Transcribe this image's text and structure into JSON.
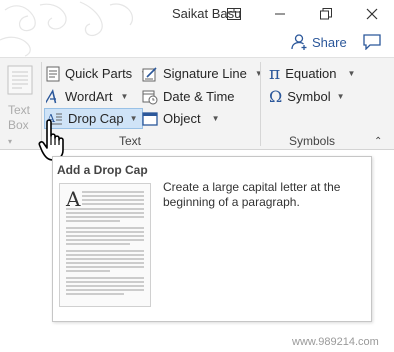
{
  "titlebar": {
    "user_name": "Saikat Basu",
    "restore_icon": "ribbon-display-icon",
    "max_icon": "restore-window-icon",
    "close_icon": "close-icon"
  },
  "share": {
    "label": "Share",
    "icon": "add-person-icon",
    "comment_icon": "comment-icon"
  },
  "ribbon": {
    "text_box": {
      "label_line1": "Text",
      "label_line2": "Box",
      "icon": "text-box-icon"
    },
    "text_group": {
      "label": "Text",
      "items": [
        {
          "label": "Quick Parts",
          "icon": "quick-parts-icon",
          "has_dropdown": true
        },
        {
          "label": "WordArt",
          "icon": "wordart-icon",
          "has_dropdown": true
        },
        {
          "label": "Drop Cap",
          "icon": "drop-cap-icon",
          "has_dropdown": true,
          "active": true
        },
        {
          "label": "Signature Line",
          "icon": "signature-line-icon",
          "has_dropdown": true
        },
        {
          "label": "Date & Time",
          "icon": "date-time-icon",
          "has_dropdown": false
        },
        {
          "label": "Object",
          "icon": "object-icon",
          "has_dropdown": true
        }
      ]
    },
    "symbols_group": {
      "label": "Symbols",
      "items": [
        {
          "label": "Equation",
          "icon": "pi-icon",
          "has_dropdown": true
        },
        {
          "label": "Symbol",
          "icon": "omega-icon",
          "has_dropdown": true
        }
      ]
    },
    "collapse_icon": "chevron-up-icon"
  },
  "tooltip": {
    "title": "Add a Drop Cap",
    "description": "Create a large capital letter at the beginning of a paragraph.",
    "preview_letter": "A"
  },
  "watermark": "www.989214.com",
  "colors": {
    "accent": "#2b579a",
    "ribbon_bg": "#f3f3f3",
    "active_bg": "#cfe3f7"
  }
}
